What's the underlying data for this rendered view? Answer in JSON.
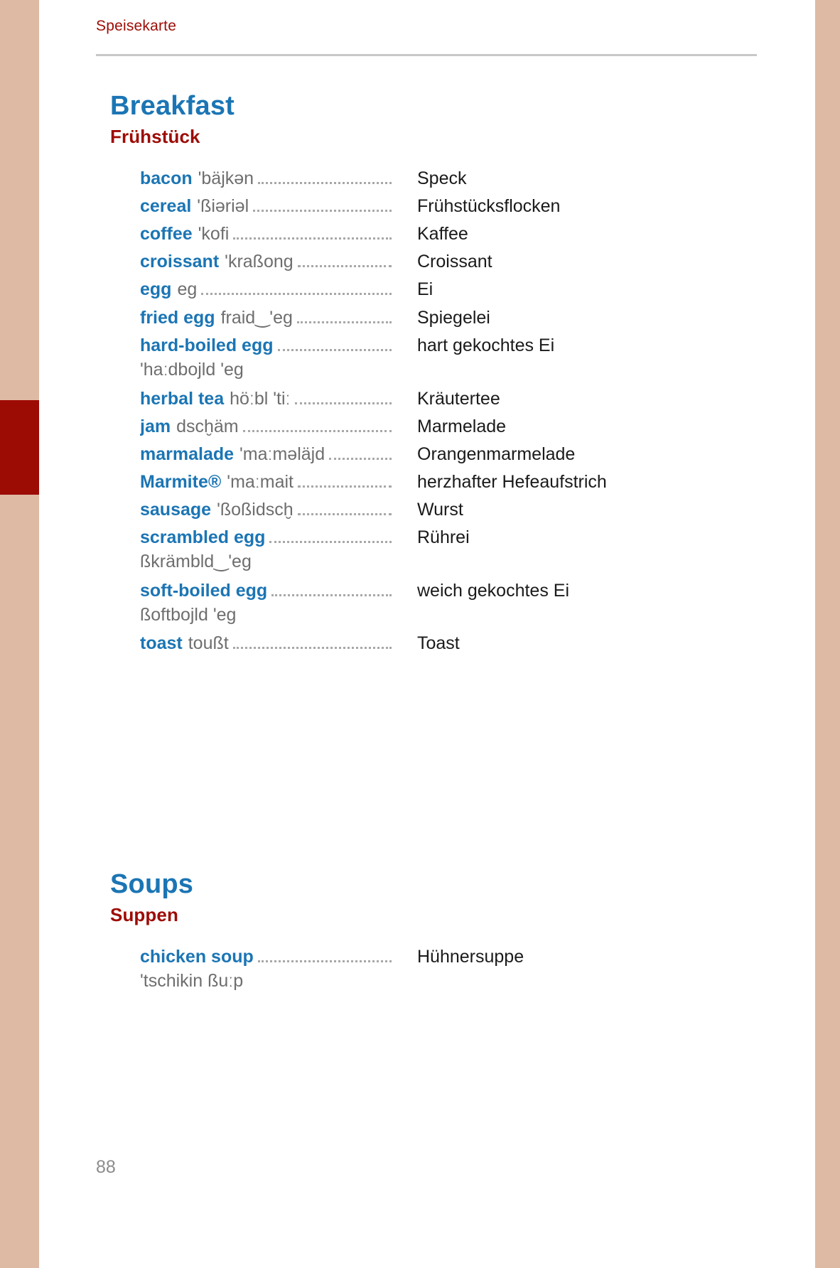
{
  "running_head": "Speisekarte",
  "page_number": "88",
  "colors": {
    "heading_blue": "#1b75b4",
    "heading_red": "#9d0b05",
    "edge_bar": "#debaa5",
    "thumb_tab": "#9d0b05",
    "pronunciation_gray": "#6e6e6e",
    "translation_black": "#1a1a1a",
    "rule_gray": "#c8c8c8"
  },
  "sections": [
    {
      "title_en": "Breakfast",
      "title_de": "Frühstück",
      "entries": [
        {
          "headword": "bacon",
          "pron": "'bäjkən",
          "pron_line2": "",
          "translation": "Speck"
        },
        {
          "headword": "cereal",
          "pron": "'ßiəriəl",
          "pron_line2": "",
          "translation": "Frühstücksflocken"
        },
        {
          "headword": "coffee",
          "pron": "'kofi",
          "pron_line2": "",
          "translation": "Kaffee"
        },
        {
          "headword": "croissant",
          "pron": "'kraßong",
          "pron_line2": "",
          "translation": "Croissant"
        },
        {
          "headword": "egg",
          "pron": "eg",
          "pron_line2": "",
          "translation": "Ei"
        },
        {
          "headword": "fried egg",
          "pron": "fraid‿'eg",
          "pron_line2": "",
          "translation": "Spiegelei"
        },
        {
          "headword": "hard-boiled egg",
          "pron": "",
          "pron_line2": "'haːdbojld 'eg",
          "translation": "hart gekochtes Ei"
        },
        {
          "headword": "herbal tea",
          "pron": "höːbl 'tiː",
          "pron_line2": "",
          "translation": "Kräutertee"
        },
        {
          "headword": "jam",
          "pron": "dscḫäm",
          "pron_line2": "",
          "translation": "Marmelade"
        },
        {
          "headword": "marmalade",
          "pron": "'maːməläjd",
          "pron_line2": "",
          "translation": "Orangenmarmelade"
        },
        {
          "headword": "Marmite®",
          "pron": "'maːmait",
          "pron_line2": "",
          "translation": "herzhafter Hefeaufstrich"
        },
        {
          "headword": "sausage",
          "pron": "'ßoßidscḫ",
          "pron_line2": "",
          "translation": "Wurst"
        },
        {
          "headword": "scrambled egg",
          "pron": "",
          "pron_line2": "ßkrämbld‿'eg",
          "translation": "Rührei"
        },
        {
          "headword": "soft-boiled egg",
          "pron": "",
          "pron_line2": "ßoftbojld 'eg",
          "translation": "weich gekochtes Ei"
        },
        {
          "headword": "toast",
          "pron": "toußt",
          "pron_line2": "",
          "translation": "Toast"
        }
      ]
    },
    {
      "title_en": "Soups",
      "title_de": "Suppen",
      "entries": [
        {
          "headword": "chicken soup",
          "pron": "",
          "pron_line2": "'tschikin ßuːp",
          "translation": "Hühnersuppe"
        }
      ]
    }
  ]
}
